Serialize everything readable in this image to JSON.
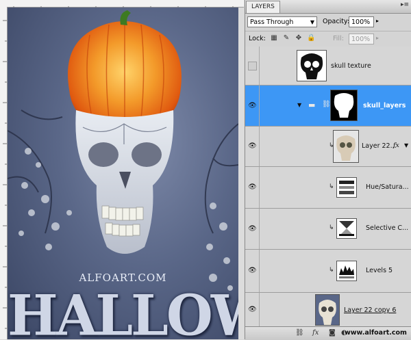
{
  "artwork": {
    "watermark": "ALFOART.COM",
    "title_text": "HALLOWE"
  },
  "panel": {
    "tab_label": "LAYERS",
    "menu_icon": "panel-menu-icon",
    "blend_mode": "Pass Through",
    "opacity_label": "Opacity:",
    "opacity_value": "100%",
    "lock_label": "Lock:",
    "fill_label": "Fill:",
    "fill_value": "100%",
    "layers": [
      {
        "name": "skull texture",
        "visible": false,
        "selected": false
      },
      {
        "name": "skull_layers",
        "visible": true,
        "selected": true,
        "type": "group"
      },
      {
        "name": "Layer 22...",
        "visible": true,
        "selected": false,
        "clipped": true,
        "fx": "fx"
      },
      {
        "name": "Hue/Satura...",
        "visible": true,
        "selected": false,
        "clipped": true,
        "type": "adjustment"
      },
      {
        "name": "Selective C...",
        "visible": true,
        "selected": false,
        "clipped": true,
        "type": "adjustment"
      },
      {
        "name": "Levels 5",
        "visible": true,
        "selected": false,
        "clipped": true,
        "type": "adjustment"
      },
      {
        "name": "Layer 22 copy 6",
        "visible": true,
        "selected": false
      }
    ],
    "footer_url": "www.alfoart.com"
  },
  "colors": {
    "selection": "#3d97f5",
    "pumpkin": "#f07a1a",
    "background": "#5a6788"
  }
}
